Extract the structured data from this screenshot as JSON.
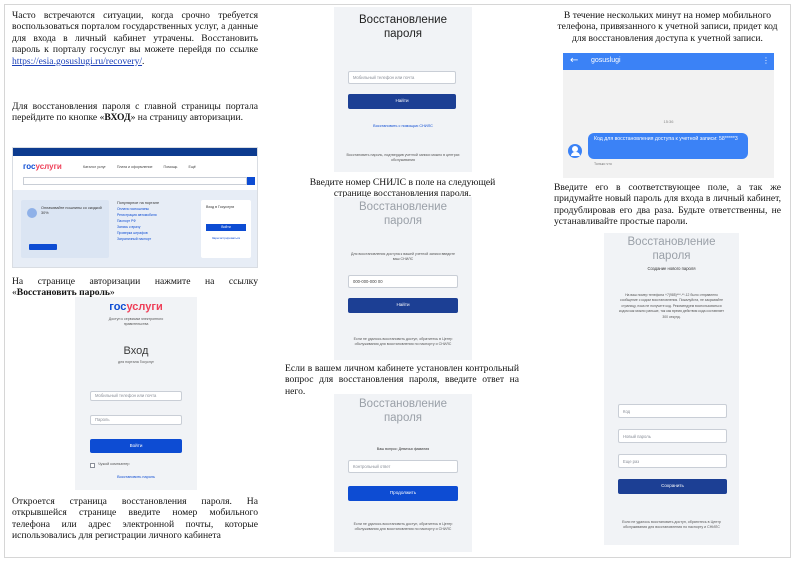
{
  "col1": {
    "p1_text": "Часто встречаются ситуации, когда срочно требуется воспользоваться порталом государственных услуг, а данные для входа в личный кабинет утрачены. Восстановить пароль к порталу госуслуг вы можете перейдя по ссылке",
    "p1_link": "https://esia.gosuslugi.ru/recovery/",
    "p1_end": ".",
    "p2_text": "Для восстановления пароля с главной страницы портала перейдите по кнопке «",
    "p2_bold": "ВХОД",
    "p2_end": "» на страницу авторизации.",
    "p3_text": "На странице авторизации нажмите на ссылку «",
    "p3_bold": "Восстановить пароль",
    "p3_end": "»",
    "p4_text": "Откроется страница восстановления пароля. На открывшейся странице введите номер мобильного телефона или адрес электронной почты, которые использовались для регистрации личного кабинета"
  },
  "col2": {
    "p1_text": "Введите номер СНИЛС в поле на следующей странице восстановления пароля.",
    "p2_text": "Если в вашем личном кабинете установлен контрольный вопрос для восстановления пароля, введите ответ на него."
  },
  "col3": {
    "p1_text": "В течение нескольких минут на номер мобильного телефона, привязанного к учетной записи, придет код для восстановления доступа к учетной записи.",
    "p2_text": "Введите его в соответствующее поле, а так же придумайте новый пароль для входа в личный кабинет, продублировав его два раза. Будьте ответственны, не устанавливайте простые пароли."
  },
  "screens": {
    "portal": {
      "logo_g": "гос",
      "logo_r": "услуги",
      "nav": [
        "Каталог услуг",
        "Плата и оформление",
        "Помощь",
        "Ещё"
      ],
      "banner_title": "Оплачивайте пошлины со скидкой 30%",
      "popular_title": "Популярное на портале",
      "popular_items": [
        "Оплата госпошлины",
        "Регистрация автомобиля",
        "Паспорт РФ",
        "Запись к врачу",
        "Проверка штрафов",
        "Заграничный паспорт"
      ],
      "login_title": "Вход в Госуслуги",
      "login_button": "Войти",
      "login_link": "Зарегистрироваться"
    },
    "login": {
      "logo_g": "гос",
      "logo_r": "услуги",
      "subtitle": "Доступ к сервисам электронного правительства",
      "title": "Вход",
      "caption": "для портала Госуслуг",
      "phone_ph": "Мобильный телефон или почта",
      "pass_ph": "Пароль",
      "button": "Войти",
      "checkbox": "Чужой компьютер",
      "restore_link": "Восстановить пароль"
    },
    "recovery_phone": {
      "title_line1": "Восстановление",
      "title_line2": "пароля",
      "input_ph": "Мобильный телефон или почта",
      "button": "Найти",
      "link": "Восстановить с помощью СНИЛС",
      "note": "Восстановить пароль, подтвердив учетной записи можно в центрах обслуживания"
    },
    "recovery_snils": {
      "title_line1": "Восстановление",
      "title_line2": "пароля",
      "hint": "Для восстановления доступа к вашей учетной записи введите ваш СНИЛС",
      "input_value": "000-000-000 00",
      "button": "Найти",
      "note": "Если не удалось восстановить доступ, обратитесь в Центр обслуживания для восстановления по паспорту и СНИЛС"
    },
    "recovery_question": {
      "title_line1": "Восстановление",
      "title_line2": "пароля",
      "question": "Ваш вопрос: Девичья фамилия",
      "input_ph": "Контрольный ответ",
      "button": "Продолжить",
      "note": "Если не удалось восстановить доступ, обратитесь в Центр обслуживания для восстановления по паспорту и СНИЛС"
    },
    "sms": {
      "app_name": "gosuslugi",
      "time": "15:36",
      "message": "Код для восстановления доступа к учетной записи: 58*****3",
      "status": "Только что"
    },
    "new_password": {
      "title_line1": "Восстановление",
      "title_line2": "пароля",
      "subtitle": "Создание нового пароля",
      "info": "На ваш номер телефона +7(985)***-**-12 было отправлено сообщение с кодом восстановления. Пожалуйста, не закрывайте страницу, пока не получите код. Рекомендуем воспользоваться кодом как можно раньше, так как время действия кода составляет 300 секунд.",
      "code_ph": "Код",
      "new_ph": "Новый пароль",
      "repeat_ph": "Еще раз",
      "button": "Сохранить",
      "note": "Если не удалось восстановить доступ, обратитесь в Центр обслуживания для восстановления по паспорту и СНИЛС"
    }
  },
  "colors": {
    "accent": "#0d4cd3",
    "brand_red": "#ee3f58",
    "sms_bar": "#3b82f6"
  }
}
